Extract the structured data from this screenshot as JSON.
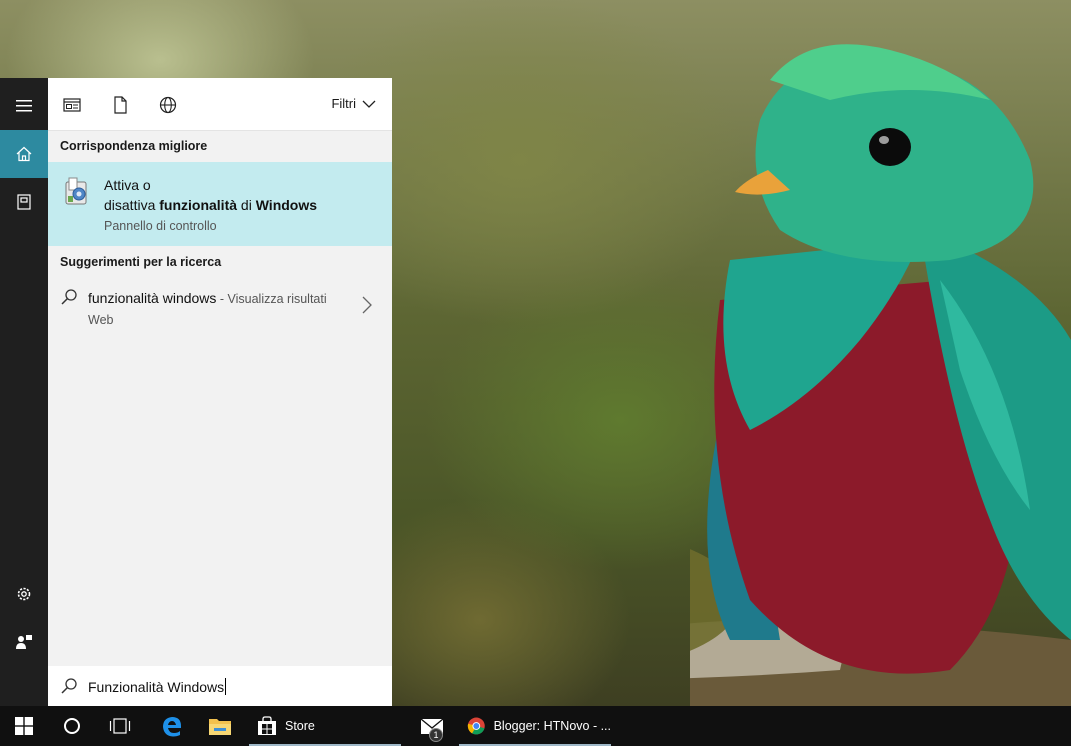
{
  "top_bar": {
    "filter_label": "Filtri"
  },
  "best_match": {
    "heading": "Corrispondenza migliore",
    "line1": "Attiva o",
    "line2_a": "disattiva ",
    "line2_bold1": "funzionalità",
    "line2_b": " di ",
    "line2_bold2": "Windows",
    "subtitle": "Pannello di controllo"
  },
  "suggestions": {
    "heading": "Suggerimenti per la ricerca",
    "items": [
      {
        "query": "funzionalità windows",
        "hint": " - Visualizza risultati Web"
      }
    ]
  },
  "search": {
    "value": "Funzionalità Windows"
  },
  "taskbar": {
    "store_label": "Store",
    "chrome_label": "Blogger: HTNovo - ...",
    "mail_badge": "1"
  },
  "colors": {
    "accent": "#2d8aa0",
    "best_match_bg": "#c3ebef",
    "rail_bg": "#1f1f1f",
    "taskbar_bg": "#101010"
  }
}
